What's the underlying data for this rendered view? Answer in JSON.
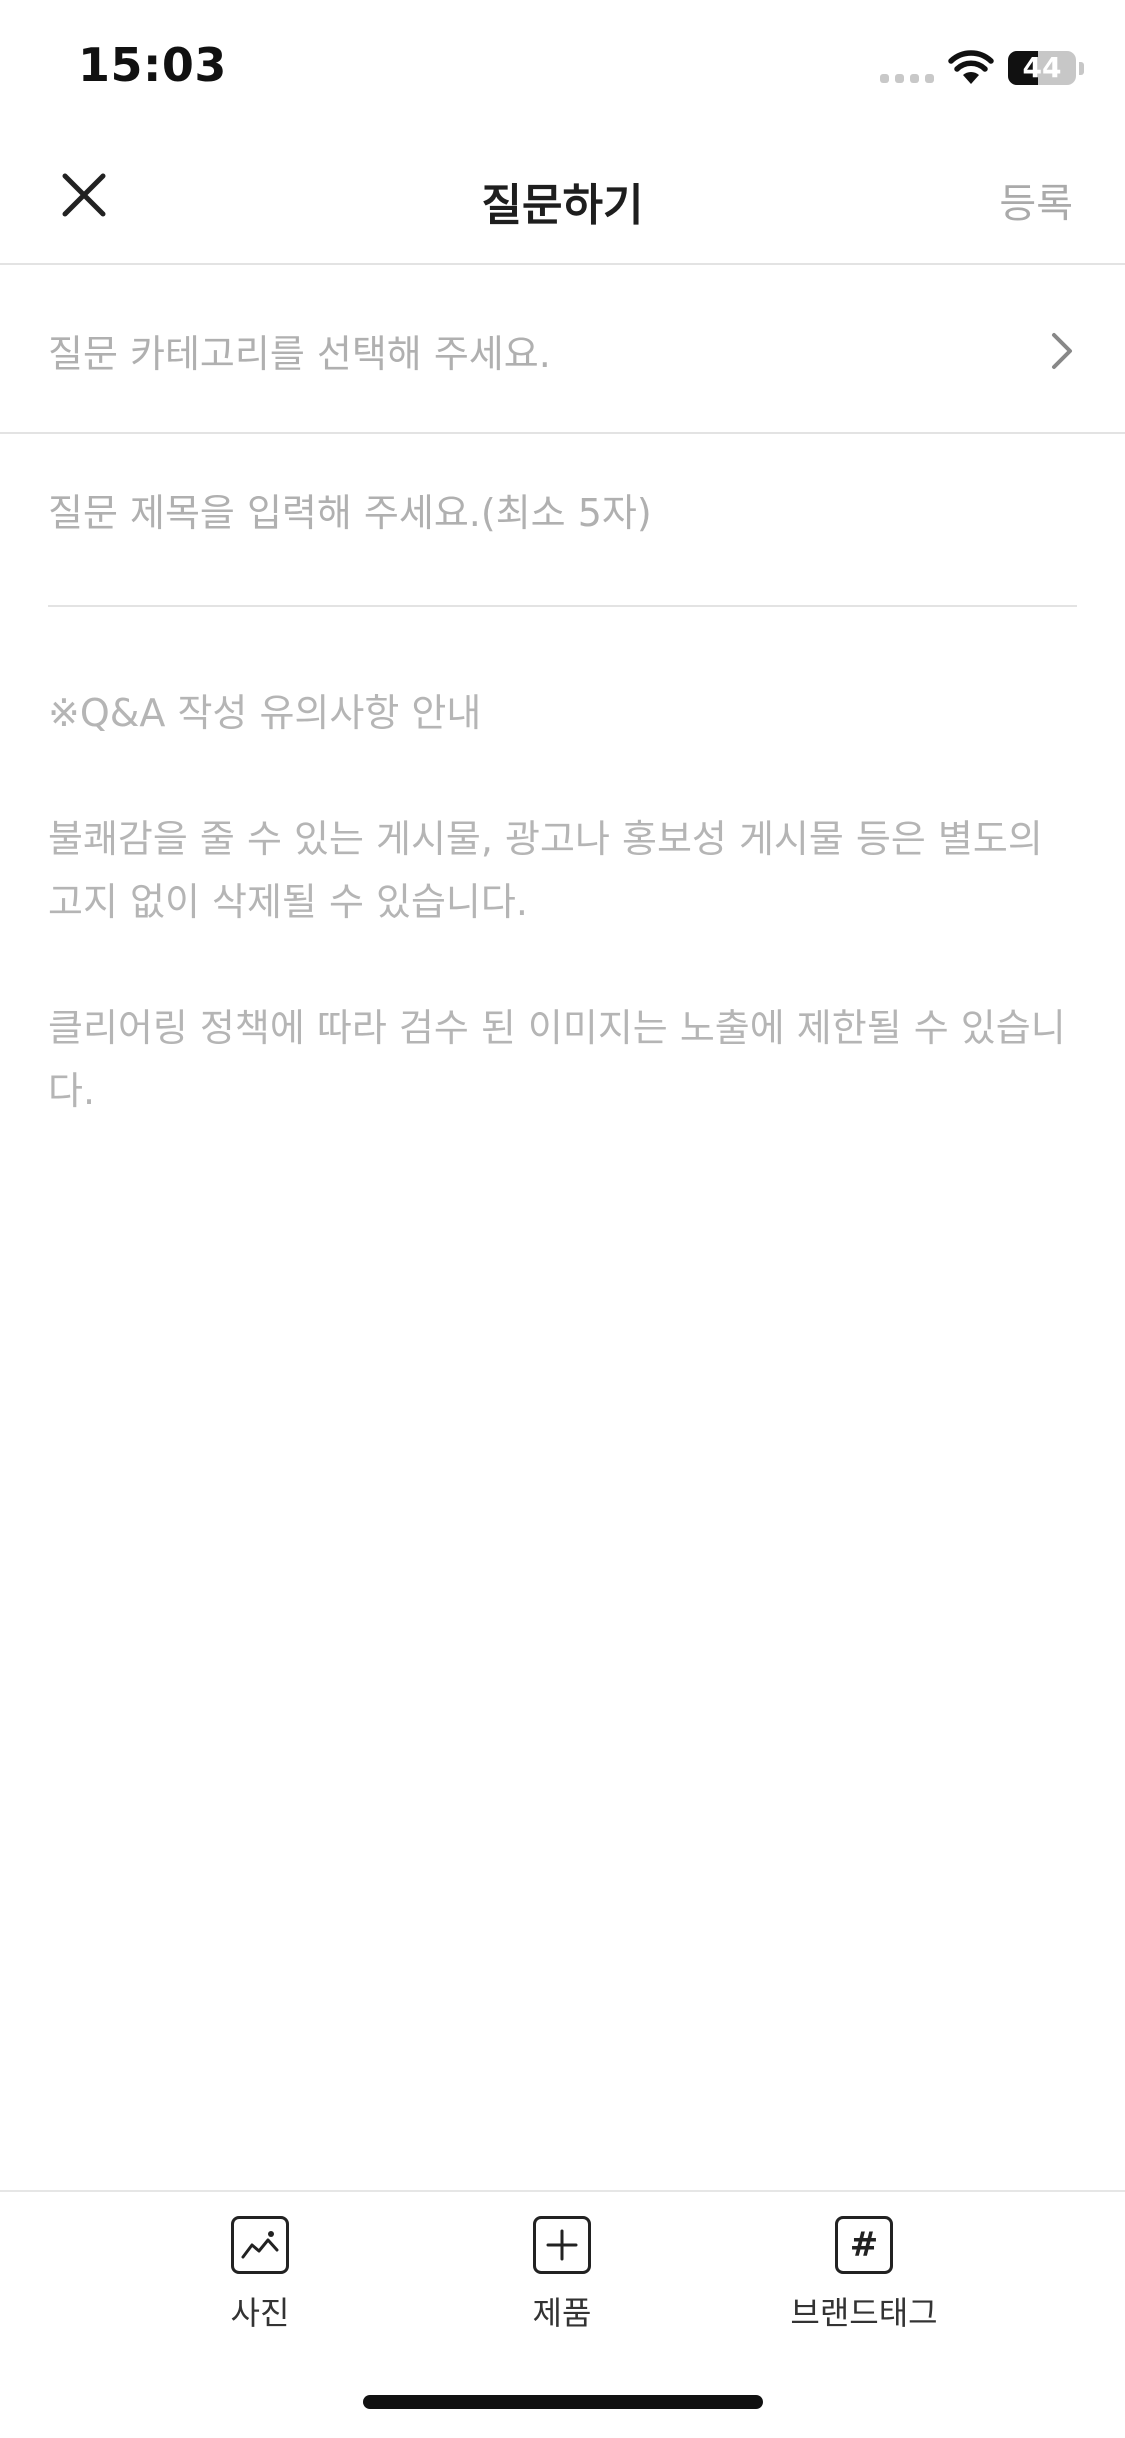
{
  "status_bar": {
    "time": "15:03",
    "battery_text": "44",
    "battery_level_percent": 44,
    "icons": [
      "cellular-signal-icon",
      "wifi-icon",
      "battery-icon"
    ]
  },
  "nav": {
    "title": "질문하기",
    "register_label": "등록",
    "close_icon": "close-icon"
  },
  "category": {
    "placeholder": "질문 카테고리를 선택해 주세요.",
    "icon": "chevron-right-icon"
  },
  "title_field": {
    "value": "",
    "placeholder": "질문 제목을 입력해 주세요.(최소 5자)"
  },
  "guide": {
    "heading": "※Q&A 작성 유의사항 안내",
    "paragraph_1": "불쾌감을 줄 수 있는 게시물, 광고나 홍보성 게시물 등은 별도의 고지 없이 삭제될 수 있습니다.",
    "paragraph_2": "클리어링 정책에 따라 검수 된 이미지는 노출에 제한될 수 있습니다."
  },
  "toolbar": {
    "photo_label": "사진",
    "product_label": "제품",
    "brandtag_label": "브랜드태그",
    "brandtag_glyph": "#",
    "icons": [
      "photo-icon",
      "plus-icon",
      "hashtag-icon"
    ]
  },
  "colors": {
    "placeholder_gray": "#b0b0b0",
    "divider": "#e3e3e3",
    "text_dark": "#1e1e1e"
  }
}
